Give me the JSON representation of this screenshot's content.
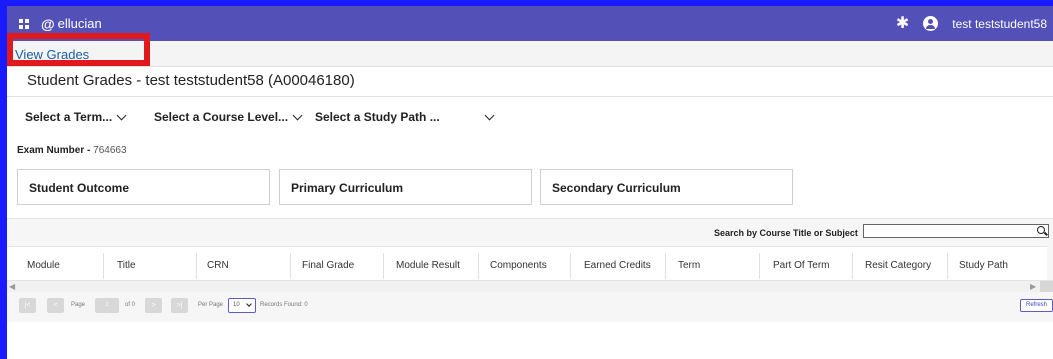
{
  "header": {
    "logo_text": "ellucian",
    "user_name": "test teststudent58"
  },
  "breadcrumb": {
    "label": "View Grades"
  },
  "page": {
    "title": "Student Grades - test teststudent58 (A00046180)"
  },
  "filters": [
    {
      "label": "Select a Term..."
    },
    {
      "label": "Select a Course Level..."
    },
    {
      "label": "Select a Study Path ..."
    }
  ],
  "exam": {
    "label": "Exam Number",
    "separator": "-",
    "value": "764663"
  },
  "cards": [
    {
      "label": "Student Outcome"
    },
    {
      "label": "Primary Curriculum"
    },
    {
      "label": "Secondary Curriculum"
    }
  ],
  "search": {
    "label": "Search by Course Title or Subject",
    "value": ""
  },
  "table": {
    "columns": [
      "Module",
      "Title",
      "CRN",
      "Final Grade",
      "Module Result",
      "Components",
      "Earned Credits",
      "Term",
      "Part Of Term",
      "Resit Category",
      "Study Path"
    ],
    "rows": []
  },
  "pager": {
    "page_label": "Page",
    "page_value": "1",
    "of_label": "of 0",
    "per_page_label": "Per Page",
    "per_page_value": "10",
    "records_label": "Records Found: 0",
    "refresh_label": "Refresh"
  },
  "colors": {
    "topbar": "#5350b8",
    "link": "#1b5fa6",
    "highlight": "#e0191f",
    "frame": "#1a1aff"
  }
}
